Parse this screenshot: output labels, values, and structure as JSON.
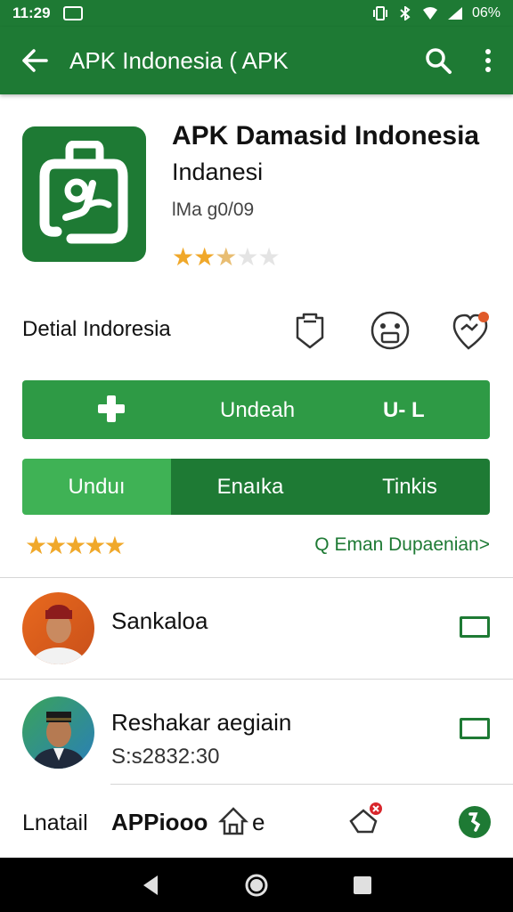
{
  "status_bar": {
    "time": "11:29",
    "battery": "06%"
  },
  "app_bar": {
    "title": "APK Indonesia ( APK",
    "back_icon": "arrow-left-icon",
    "search_icon": "search-icon",
    "menu_icon": "more-vert-icon"
  },
  "app": {
    "name": "APK Damasid Indonesia",
    "developer": "Indanesi",
    "meta": "lMa g0/09",
    "rating_stars": 2.5,
    "icon": "bag-app-icon"
  },
  "detail": {
    "label": "Detial Indoresia",
    "icons": [
      "shield-tag-icon",
      "face-icon",
      "location-heart-icon"
    ]
  },
  "install_button": {
    "label": "Undeah",
    "size": "U- L"
  },
  "tabs": [
    {
      "label": "Unduı",
      "active": true
    },
    {
      "label": "Enaıka",
      "active": false
    },
    {
      "label": "Tinkis",
      "active": false
    }
  ],
  "rating_row": {
    "stars": "★★★★★",
    "link": "Q Eman Dupaenian>"
  },
  "list": [
    {
      "title": "Sankaloa",
      "subtitle": ""
    },
    {
      "title": "Reshakar aegiain",
      "subtitle": "S:s2832:30"
    }
  ],
  "bottom_row": {
    "label": "Lnatail",
    "app_label": "APPiooo",
    "suffix": "e"
  },
  "colors": {
    "primary": "#1e7a34",
    "button": "#2e9a45",
    "tab_active": "#3fb255",
    "star": "#f0a82a"
  }
}
